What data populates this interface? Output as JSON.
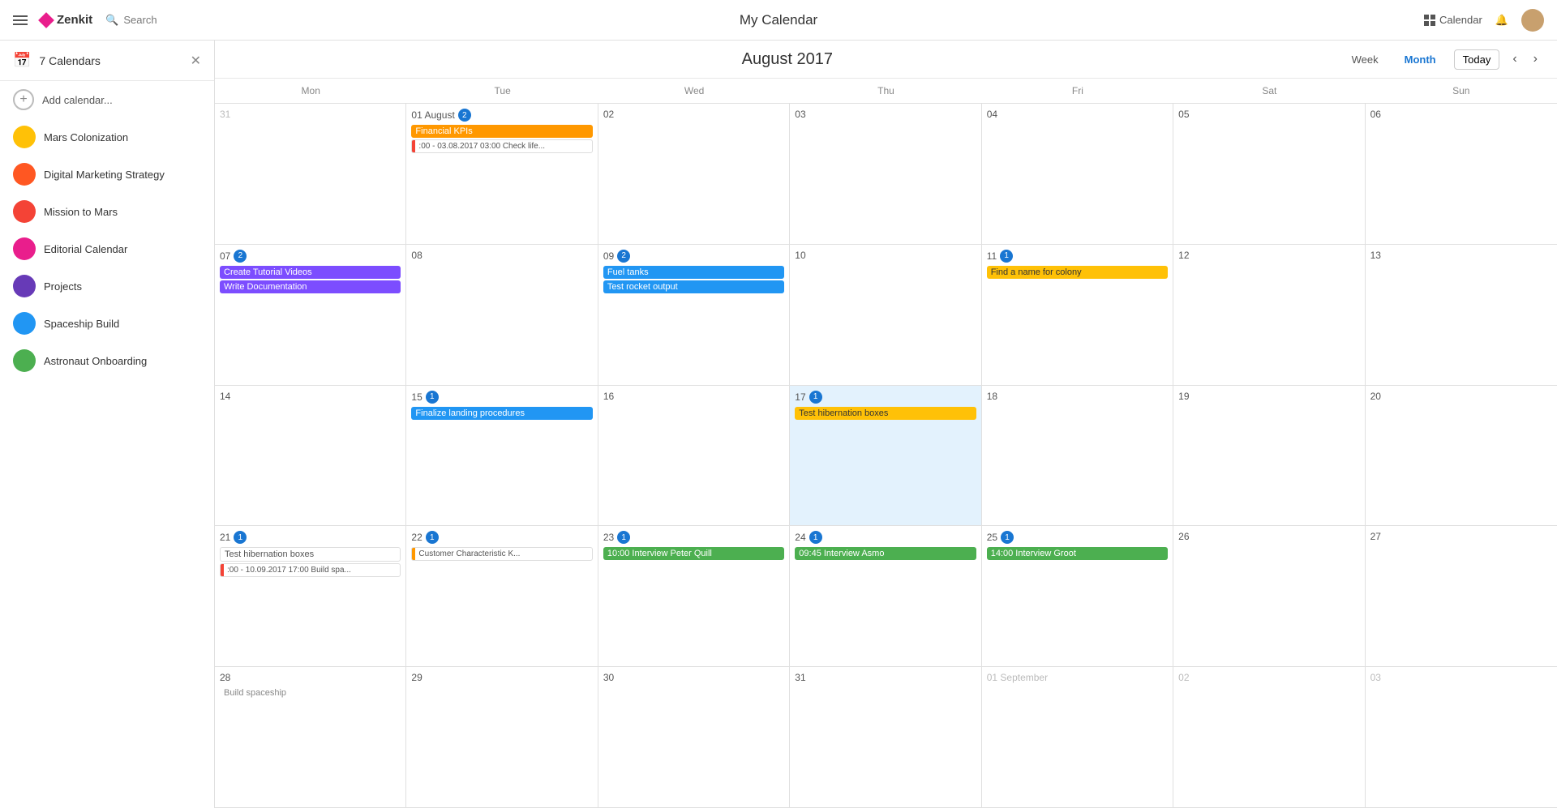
{
  "app": {
    "name": "Zenkit",
    "title": "My Calendar",
    "search_label": "Search",
    "calendar_label": "Calendar"
  },
  "sidebar": {
    "title": "7 Calendars",
    "add_label": "Add calendar...",
    "calendars": [
      {
        "id": "mars-col",
        "label": "Mars Colonization",
        "color": "#ffc107",
        "icon": "star"
      },
      {
        "id": "dig-mkt",
        "label": "Digital Marketing Strategy",
        "color": "#ff5722",
        "icon": "flame"
      },
      {
        "id": "mission",
        "label": "Mission to Mars",
        "color": "#f44336",
        "icon": "rocket"
      },
      {
        "id": "editorial",
        "label": "Editorial Calendar",
        "color": "#e91e8c",
        "icon": "pencil"
      },
      {
        "id": "projects",
        "label": "Projects",
        "color": "#673ab7",
        "icon": "folder"
      },
      {
        "id": "spaceship",
        "label": "Spaceship Build",
        "color": "#2196f3",
        "icon": "ship"
      },
      {
        "id": "astronaut",
        "label": "Astronaut Onboarding",
        "color": "#4caf50",
        "icon": "check"
      }
    ]
  },
  "calendar": {
    "month_title": "August 2017",
    "week_label": "Week",
    "month_label": "Month",
    "today_label": "Today",
    "day_headers": [
      "Mon",
      "Tue",
      "Wed",
      "Thu",
      "Fri",
      "Sat",
      "Sun"
    ],
    "weeks": [
      {
        "days": [
          {
            "num": "31",
            "other": true,
            "badge": 0,
            "events": []
          },
          {
            "num": "01 August",
            "badge": 2,
            "events": [
              {
                "label": "Financial KPIs",
                "type": "orange"
              },
              {
                "label": ":00 - 03.08.2017 03:00 Check life...",
                "type": "multi"
              }
            ]
          },
          {
            "num": "02",
            "badge": 0,
            "events": []
          },
          {
            "num": "03",
            "badge": 0,
            "events": []
          },
          {
            "num": "04",
            "badge": 0,
            "events": []
          },
          {
            "num": "05",
            "badge": 0,
            "events": []
          },
          {
            "num": "06",
            "badge": 0,
            "events": []
          }
        ]
      },
      {
        "days": [
          {
            "num": "07",
            "badge": 2,
            "events": [
              {
                "label": "Create Tutorial Videos",
                "type": "purple"
              },
              {
                "label": "Write Documentation",
                "type": "purple"
              }
            ]
          },
          {
            "num": "08",
            "badge": 0,
            "events": []
          },
          {
            "num": "09",
            "badge": 2,
            "events": [
              {
                "label": "Fuel tanks",
                "type": "blue"
              },
              {
                "label": "Test rocket output",
                "type": "blue"
              }
            ]
          },
          {
            "num": "10",
            "badge": 0,
            "events": []
          },
          {
            "num": "11",
            "badge": 1,
            "events": [
              {
                "label": "Find a name for colony",
                "type": "yellow"
              }
            ]
          },
          {
            "num": "12",
            "badge": 0,
            "events": []
          },
          {
            "num": "13",
            "badge": 0,
            "events": []
          }
        ]
      },
      {
        "days": [
          {
            "num": "14",
            "badge": 0,
            "events": []
          },
          {
            "num": "15",
            "badge": 1,
            "events": [
              {
                "label": "Finalize landing procedures",
                "type": "blue",
                "span": true
              }
            ]
          },
          {
            "num": "16",
            "badge": 0,
            "events": []
          },
          {
            "num": "17",
            "badge": 1,
            "highlight": true,
            "events": [
              {
                "label": "Test hibernation boxes",
                "type": "yellow",
                "small": true
              }
            ]
          },
          {
            "num": "18",
            "badge": 0,
            "events": []
          },
          {
            "num": "19",
            "badge": 0,
            "events": []
          },
          {
            "num": "20",
            "badge": 0,
            "events": []
          }
        ]
      },
      {
        "days": [
          {
            "num": "21",
            "badge": 1,
            "events": [
              {
                "label": "Test hibernation boxes",
                "type": "outline"
              },
              {
                "label": ":00 - 10.09.2017 17:00 Build spa...",
                "type": "multi"
              }
            ]
          },
          {
            "num": "22",
            "badge": 1,
            "events": [
              {
                "label": "Customer Characteristic K...",
                "type": "multi-orange"
              }
            ]
          },
          {
            "num": "23",
            "badge": 1,
            "events": [
              {
                "label": "10:00 Interview Peter Quill",
                "type": "green"
              }
            ]
          },
          {
            "num": "24",
            "badge": 1,
            "events": [
              {
                "label": "09:45 Interview Asmo",
                "type": "green"
              }
            ]
          },
          {
            "num": "25",
            "badge": 1,
            "events": [
              {
                "label": "14:00 Interview Groot",
                "type": "green"
              }
            ]
          },
          {
            "num": "26",
            "badge": 0,
            "events": []
          },
          {
            "num": "27",
            "badge": 0,
            "events": []
          }
        ]
      },
      {
        "days": [
          {
            "num": "28",
            "badge": 0,
            "events": [
              {
                "label": "Build spaceship",
                "type": "outline-gray"
              }
            ]
          },
          {
            "num": "29",
            "badge": 0,
            "events": []
          },
          {
            "num": "30",
            "badge": 0,
            "events": []
          },
          {
            "num": "31",
            "badge": 0,
            "events": []
          },
          {
            "num": "01 September",
            "other": true,
            "badge": 0,
            "events": []
          },
          {
            "num": "02",
            "other": true,
            "badge": 0,
            "events": []
          },
          {
            "num": "03",
            "other": true,
            "badge": 0,
            "events": []
          }
        ]
      }
    ]
  }
}
